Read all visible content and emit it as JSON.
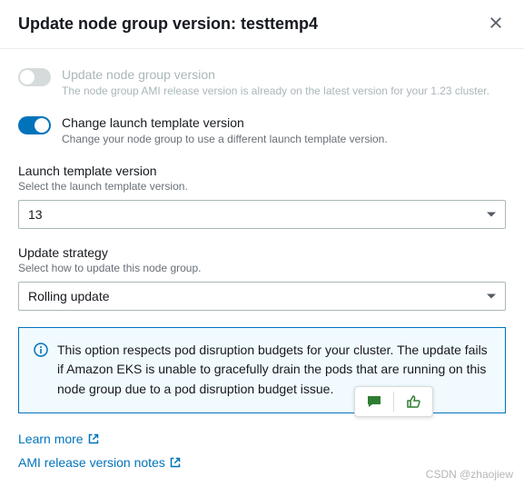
{
  "header": {
    "title": "Update node group version: testtemp4"
  },
  "toggles": {
    "update_version": {
      "label": "Update node group version",
      "desc": "The node group AMI release version is already on the latest version for your 1.23 cluster.",
      "enabled": false
    },
    "change_template": {
      "label": "Change launch template version",
      "desc": "Change your node group to use a different launch template version.",
      "enabled": true
    }
  },
  "launch_template": {
    "label": "Launch template version",
    "desc": "Select the launch template version.",
    "value": "13"
  },
  "update_strategy": {
    "label": "Update strategy",
    "desc": "Select how to update this node group.",
    "value": "Rolling update"
  },
  "info_box": {
    "text": "This option respects pod disruption budgets for your cluster. The update fails if Amazon EKS is unable to gracefully drain the pods that are running on this node group due to a pod disruption budget issue."
  },
  "links": {
    "learn_more": "Learn more",
    "ami_notes": "AMI release version notes"
  },
  "watermark": "CSDN @zhaojiew"
}
